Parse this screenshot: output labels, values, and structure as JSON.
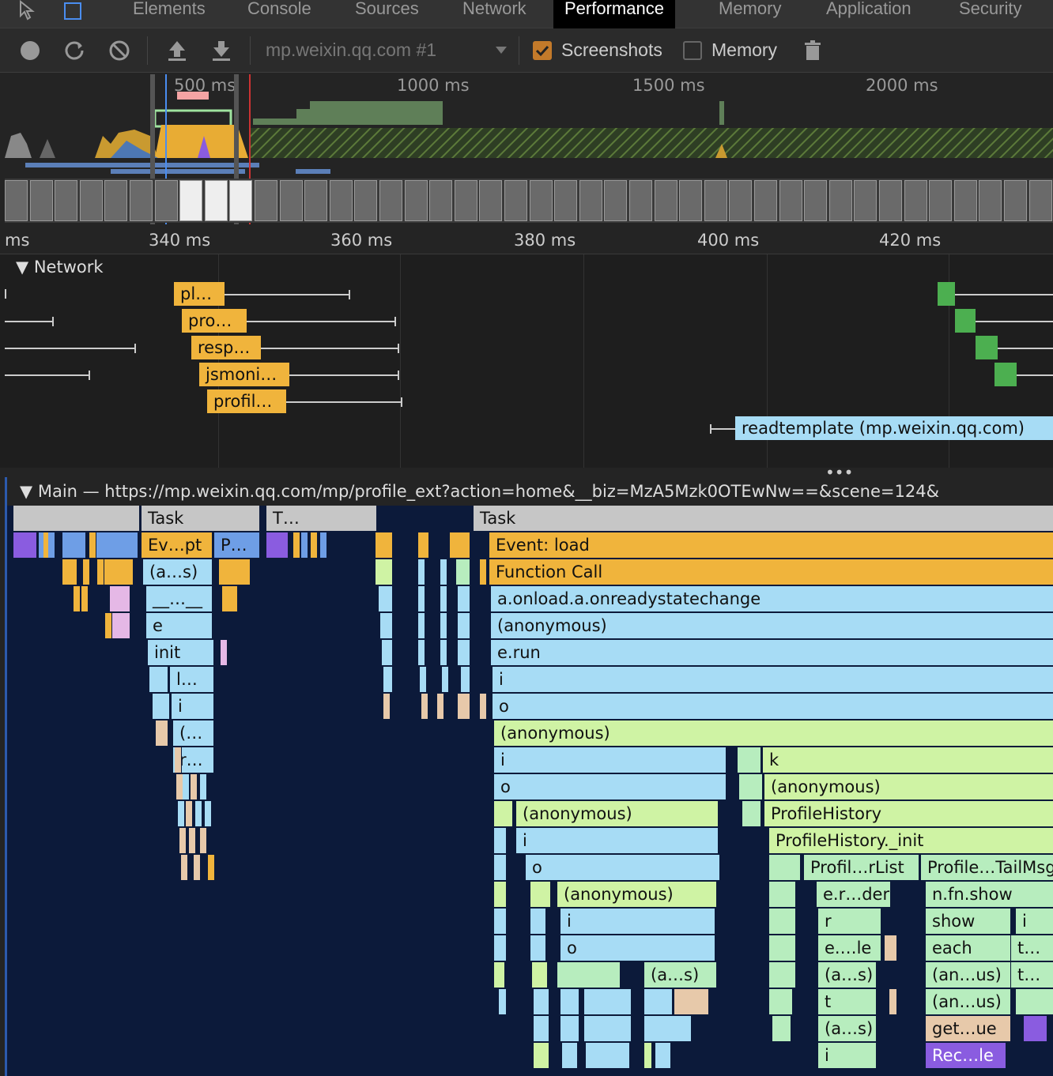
{
  "tabs": [
    {
      "label": "Elements"
    },
    {
      "label": "Console"
    },
    {
      "label": "Sources"
    },
    {
      "label": "Network"
    },
    {
      "label": "Performance",
      "active": true
    },
    {
      "label": "Memory"
    },
    {
      "label": "Application"
    },
    {
      "label": "Security"
    }
  ],
  "toolbar": {
    "target": "mp.weixin.qq.com #1",
    "screenshots_label": "Screenshots",
    "screenshots_checked": true,
    "memory_label": "Memory",
    "memory_checked": false
  },
  "overview": {
    "ticks": [
      "500 ms",
      "1000 ms",
      "1500 ms",
      "2000 ms"
    ]
  },
  "ruler": {
    "ticks": [
      "ms",
      "340 ms",
      "360 ms",
      "380 ms",
      "400 ms",
      "420 ms"
    ]
  },
  "network": {
    "title": "Network",
    "requests": [
      {
        "label": "pl…"
      },
      {
        "label": "pro…"
      },
      {
        "label": "resp…"
      },
      {
        "label": "jsmoni…"
      },
      {
        "label": "profil…"
      },
      {
        "label": "readtemplate (mp.weixin.qq.com)"
      }
    ]
  },
  "main": {
    "title": "Main — https://mp.weixin.qq.com/mp/profile_ext?action=home&__biz=MzA5Mzk0OTEwNw==&scene=124&",
    "rows": {
      "task_a": "Task",
      "task_b": "T…",
      "task_c": "Task",
      "ev_pt": "Ev…pt",
      "p_dots": "P…",
      "event_load": "Event: load",
      "as1": "(a…s)",
      "function_call": "Function Call",
      "dunder": "__…__",
      "onload": "a.onload.a.onreadystatechange",
      "e": "e",
      "anon1": "(anonymous)",
      "init": "init",
      "erun": "e.run",
      "l_dots": "l…",
      "i1": "i",
      "i2": "i",
      "o1": "o",
      "paren": "(…",
      "anon2": "(anonymous)",
      "r_dots": "r…",
      "i3": "i",
      "k": "k",
      "o2": "o",
      "anon3": "(anonymous)",
      "anon4": "(anonymous)",
      "profile_history": "ProfileHistory",
      "i4": "i",
      "ph_init": "ProfileHistory._init",
      "o3": "o",
      "profil_rlist": "Profil…rList",
      "profile_tail": "Profile…TailMsg",
      "anon5": "(anonymous)",
      "erder": "e.r…der",
      "nfnshow": "n.fn.show",
      "i5": "i",
      "r": "r",
      "show": "show",
      "i6": "i",
      "o4": "o",
      "ele": "e.…le",
      "each": "each",
      "t_dots1": "t…",
      "as2": "(a…s)",
      "as3": "(a…s)",
      "anus1": "(an…us)",
      "t_dots2": "t…",
      "t": "t",
      "anus2": "(an…us)",
      "as4": "(a…s)",
      "getue": "get…ue",
      "i7": "i",
      "recle": "Rec…le"
    }
  },
  "colors": {
    "task": "#c6c6c6",
    "event": "#f0b43c",
    "blue": "#a7dcf5",
    "green": "#cff3a4",
    "purple": "#8a5ce0",
    "peach": "#e7c9aa",
    "network_request": "#f0b43c",
    "network_doc": "#a7dcf5",
    "network_green": "#4caf50"
  }
}
